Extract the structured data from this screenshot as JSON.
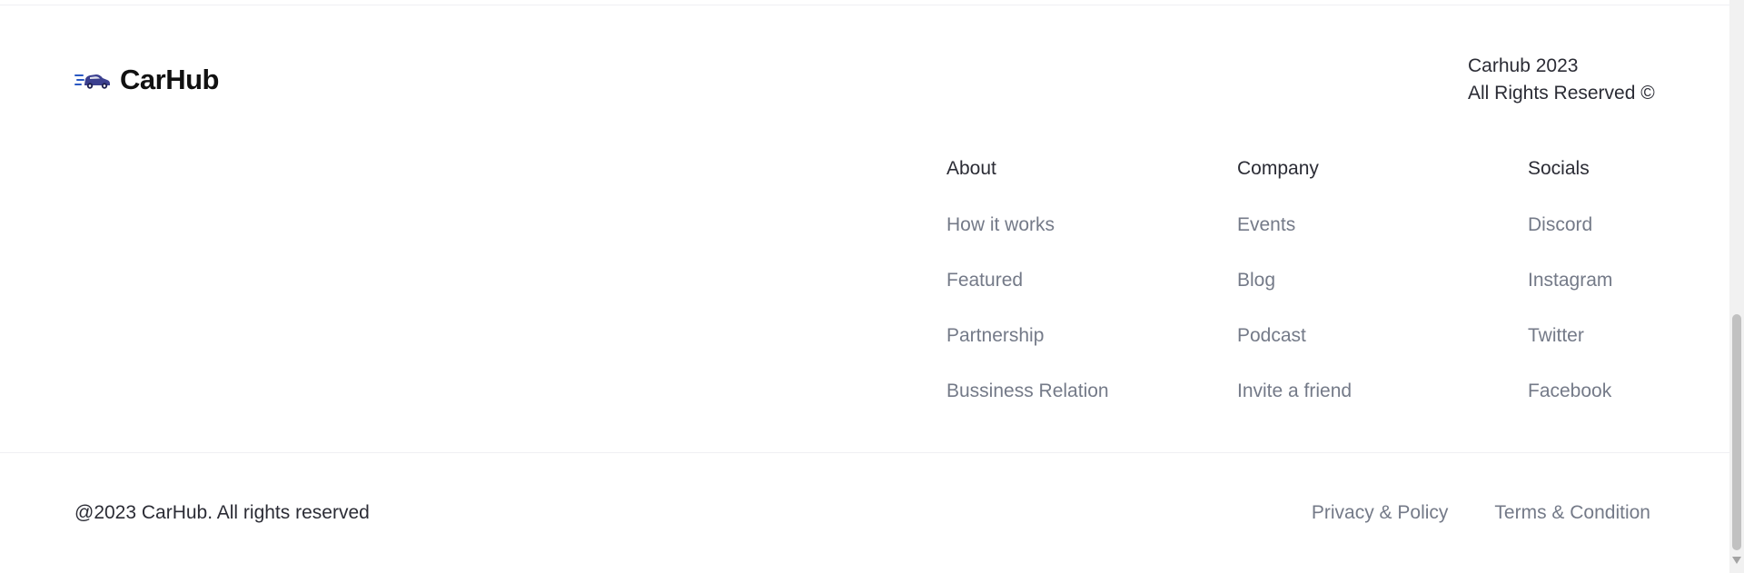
{
  "brand": {
    "name": "CarHub",
    "icon": "car-logo-icon",
    "color": "#2b59c3"
  },
  "copyright_block": {
    "line1": "Carhub 2023",
    "line2": "All Rights Reserved ©"
  },
  "columns": [
    {
      "title": "About",
      "links": [
        "How it works",
        "Featured",
        "Partnership",
        "Bussiness Relation"
      ]
    },
    {
      "title": "Company",
      "links": [
        "Events",
        "Blog",
        "Podcast",
        "Invite a friend"
      ]
    },
    {
      "title": "Socials",
      "links": [
        "Discord",
        "Instagram",
        "Twitter",
        "Facebook"
      ]
    }
  ],
  "bottom": {
    "copyright": "@2023 CarHub. All rights reserved",
    "privacy": "Privacy & Policy",
    "terms": "Terms & Condition"
  },
  "colors": {
    "text_dark": "#2b2c35",
    "text_gray": "#747a88",
    "divider": "#f0f0f3"
  }
}
